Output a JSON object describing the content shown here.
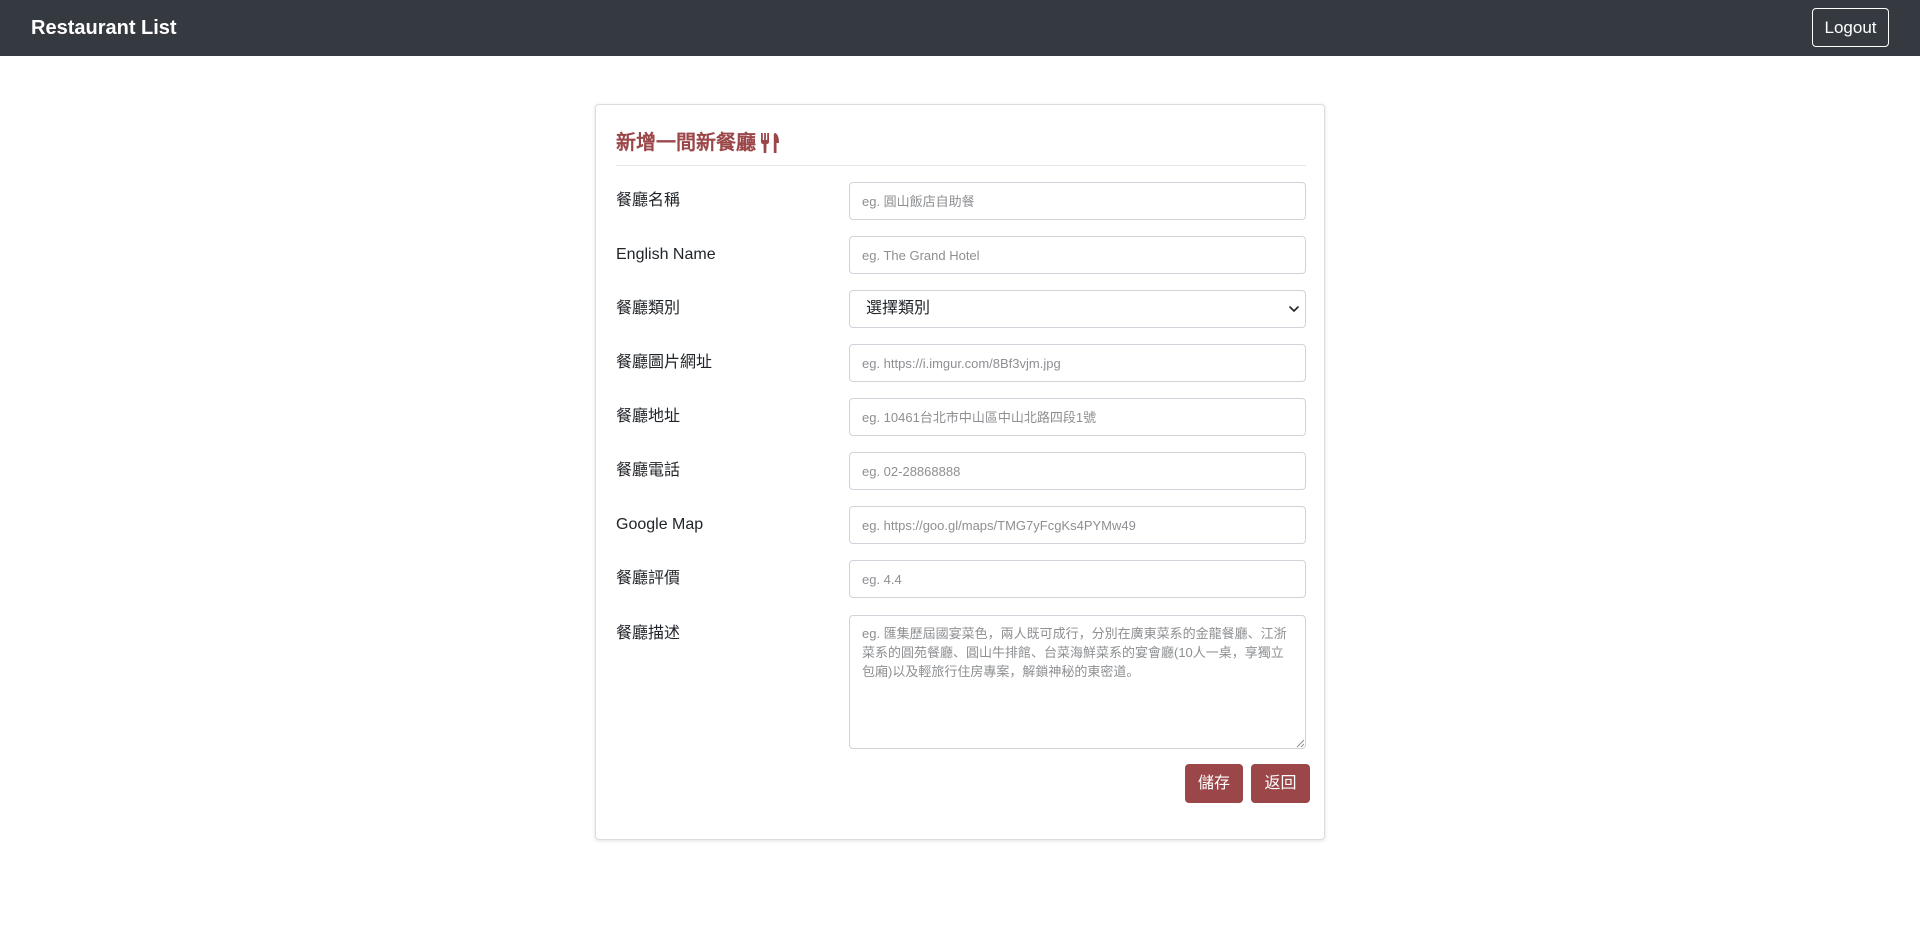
{
  "navbar": {
    "brand": "Restaurant List",
    "logout_label": "Logout",
    "background": "#343a40"
  },
  "form": {
    "title": "新增一間新餐廳",
    "title_icon": "utensils-icon",
    "accent_color": "#9b4749",
    "fields": {
      "name": {
        "label": "餐廳名稱",
        "placeholder": "eg. 圓山飯店自助餐",
        "value": ""
      },
      "name_en": {
        "label": "English Name",
        "placeholder": "eg. The Grand Hotel",
        "value": ""
      },
      "category": {
        "label": "餐廳類別",
        "selected": "選擇類別"
      },
      "image": {
        "label": "餐廳圖片網址",
        "placeholder": "eg. https://i.imgur.com/8Bf3vjm.jpg",
        "value": ""
      },
      "location": {
        "label": "餐廳地址",
        "placeholder": "eg. 10461台北市中山區中山北路四段1號",
        "value": ""
      },
      "phone": {
        "label": "餐廳電話",
        "placeholder": "eg. 02-28868888",
        "value": ""
      },
      "google_map": {
        "label": "Google Map",
        "placeholder": "eg. https://goo.gl/maps/TMG7yFcgKs4PYMw49",
        "value": ""
      },
      "rating": {
        "label": "餐廳評價",
        "placeholder": "eg. 4.4",
        "value": ""
      },
      "description": {
        "label": "餐廳描述",
        "placeholder": "eg. 匯集歷屆國宴菜色，兩人既可成行，分別在廣東菜系的金龍餐廳、江浙菜系的圓苑餐廳、圓山牛排館、台菜海鮮菜系的宴會廳(10人一桌，享獨立包廂)以及輕旅行住房專案，解鎖神秘的東密道。",
        "value": ""
      }
    },
    "buttons": {
      "save_label": "儲存",
      "back_label": "返回"
    }
  }
}
